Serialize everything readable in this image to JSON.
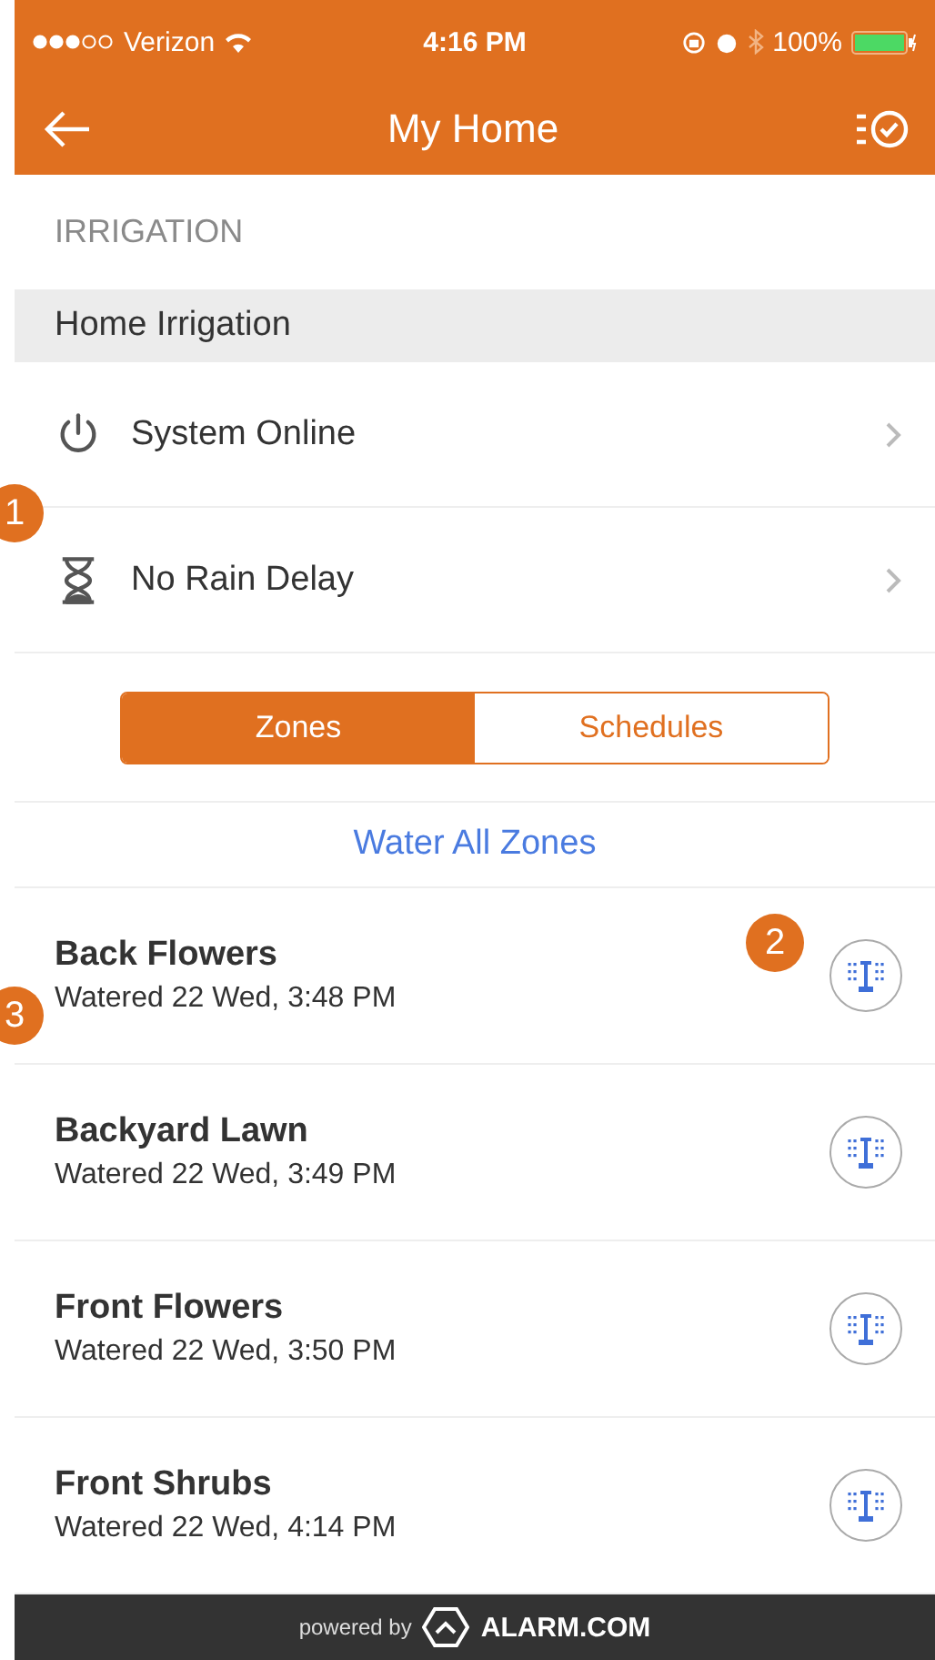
{
  "status_bar": {
    "carrier": "Verizon",
    "time": "4:16 PM",
    "battery": "100%"
  },
  "nav": {
    "title": "My Home"
  },
  "section_title": "IRRIGATION",
  "group_title": "Home Irrigation",
  "rows": [
    {
      "kind": "power",
      "label": "System Online"
    },
    {
      "kind": "hourglass",
      "label": "No Rain Delay"
    }
  ],
  "segments": [
    {
      "label": "Zones",
      "selected": true
    },
    {
      "label": "Schedules",
      "selected": false
    }
  ],
  "water_all": "Water All Zones",
  "zones": [
    {
      "name": "Back Flowers",
      "watered": "Watered 22 Wed, 3:48 PM"
    },
    {
      "name": "Backyard Lawn",
      "watered": "Watered 22 Wed, 3:49 PM"
    },
    {
      "name": "Front Flowers",
      "watered": "Watered 22 Wed, 3:50 PM"
    },
    {
      "name": "Front Shrubs",
      "watered": "Watered 22 Wed, 4:14 PM"
    }
  ],
  "footer": {
    "prefix": "powered by",
    "brand": "ALARM.COM"
  },
  "callouts": [
    {
      "label": "1"
    },
    {
      "label": "2"
    },
    {
      "label": "3"
    }
  ]
}
